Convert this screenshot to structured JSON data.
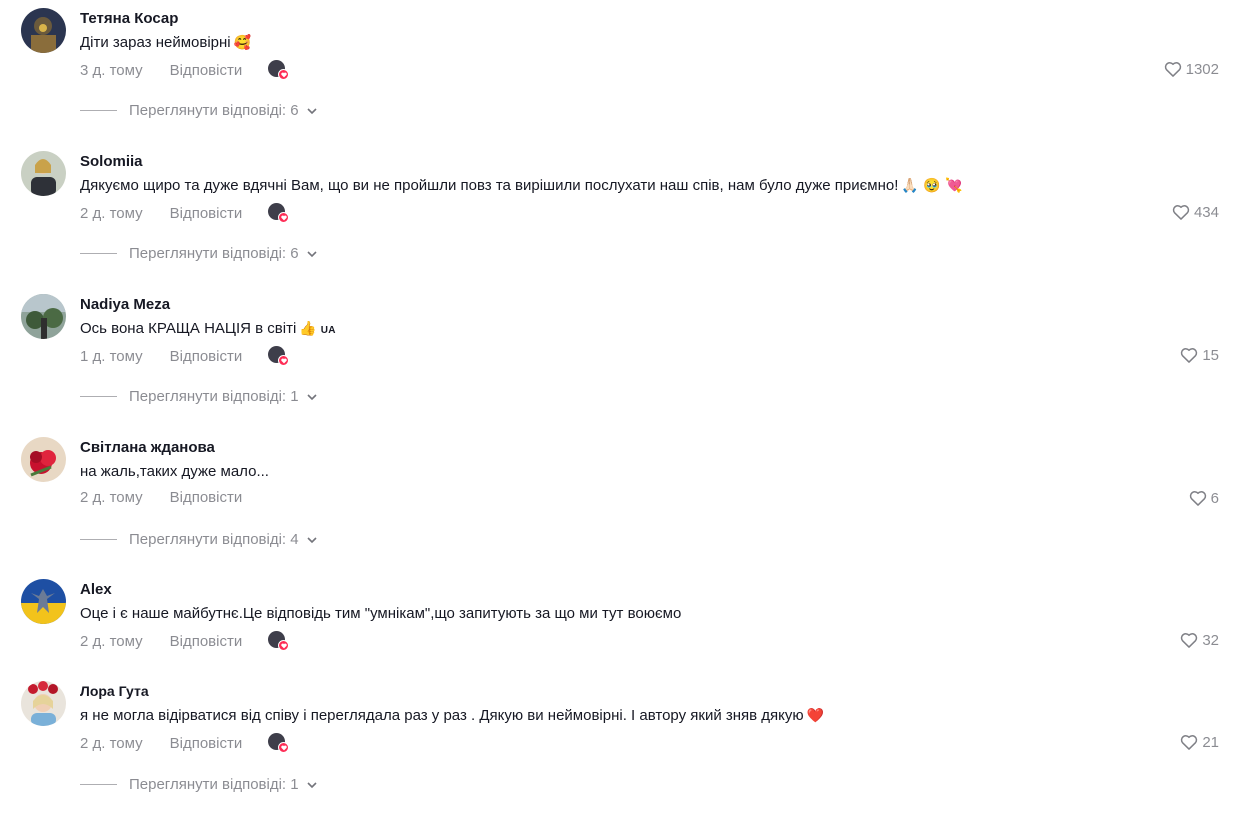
{
  "comments": [
    {
      "author": "Тетяна Косар",
      "text": "Діти зараз неймовірні",
      "emoji": "🥰",
      "time": "3 д. тому",
      "reply_label": "Відповісти",
      "likes": "1302",
      "view_replies": "Переглянути відповіді: 6"
    },
    {
      "author": "Solomiia",
      "text": "Дякуємо щиро та дуже вдячні Вам, що ви не пройшли повз та вирішили послухати наш спів, нам було дуже приємно!",
      "emoji": "🙏🏻 🥹 💘",
      "time": "2 д. тому",
      "reply_label": "Відповісти",
      "likes": "434",
      "view_replies": "Переглянути відповіді: 6"
    },
    {
      "author": "Nadiya Meza",
      "text": "Ось вона КРАЩА НАЦІЯ в світі",
      "emoji": "👍",
      "flag": "UA",
      "time": "1 д. тому",
      "reply_label": "Відповісти",
      "likes": "15",
      "view_replies": "Переглянути відповіді: 1"
    },
    {
      "author": "Світлана жданова",
      "text": "на жаль,таких дуже мало...",
      "time": "2 д. тому",
      "reply_label": "Відповісти",
      "likes": "6",
      "view_replies": "Переглянути відповіді: 4"
    },
    {
      "author": "Alex",
      "text": "Оце і є наше майбутнє.Це відповідь тим \"умнікам\",що запитують за що ми тут воюємо",
      "time": "2 д. тому",
      "reply_label": "Відповісти",
      "likes": "32"
    },
    {
      "author": "Лора Гута",
      "text": "я не могла відірватися від співу і переглядала раз у раз . Дякую ви неймовірні. І автору який зняв дякую",
      "emoji": "❤️",
      "time": "2 д. тому",
      "reply_label": "Відповісти",
      "likes": "21",
      "view_replies": "Переглянути відповіді: 1"
    }
  ],
  "colors": {
    "text_primary": "#161823",
    "text_secondary": "rgba(22,24,35,0.5)",
    "badge_heart": "#fe2c55"
  },
  "icons": {
    "like": "heart-outline-icon",
    "expand": "chevron-down-icon",
    "creator_liked": "creator-liked-badge-icon"
  }
}
